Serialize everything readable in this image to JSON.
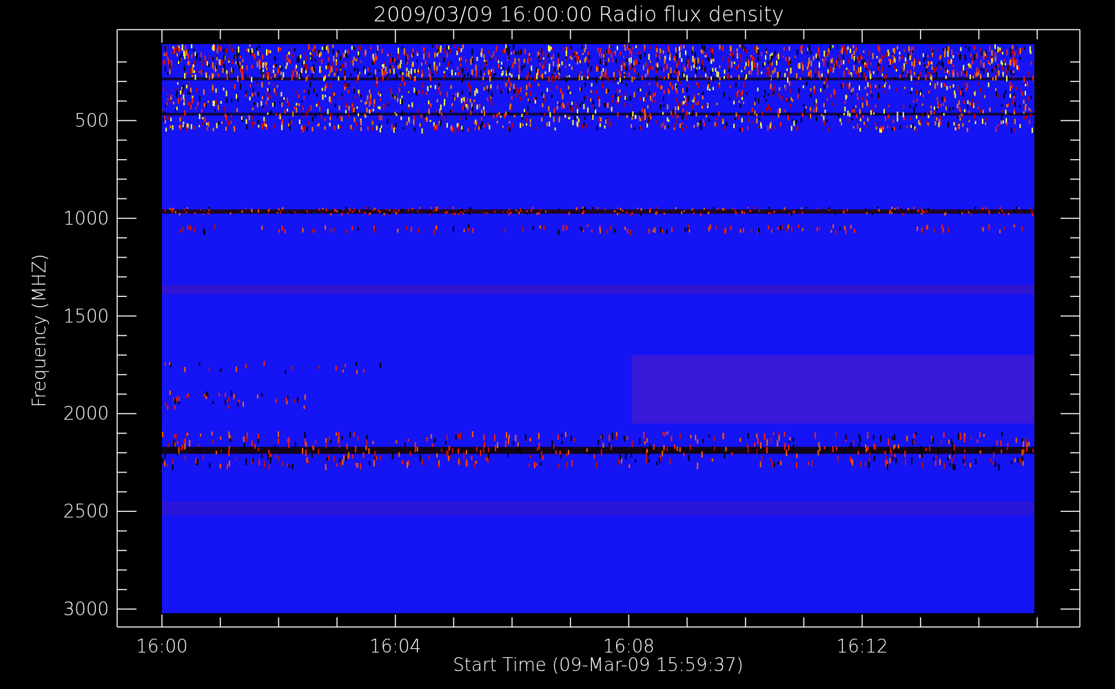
{
  "title": "2009/03/09 16:00:00 Radio flux density",
  "y_axis": {
    "label": "Frequency (MHZ)",
    "ticks": [
      "500",
      "1000",
      "1500",
      "2000",
      "2500",
      "3000"
    ]
  },
  "x_axis": {
    "label": "Start Time (09-Mar-09 15:59:37)",
    "ticks": [
      "16:00",
      "16:04",
      "16:08",
      "16:12"
    ]
  }
}
